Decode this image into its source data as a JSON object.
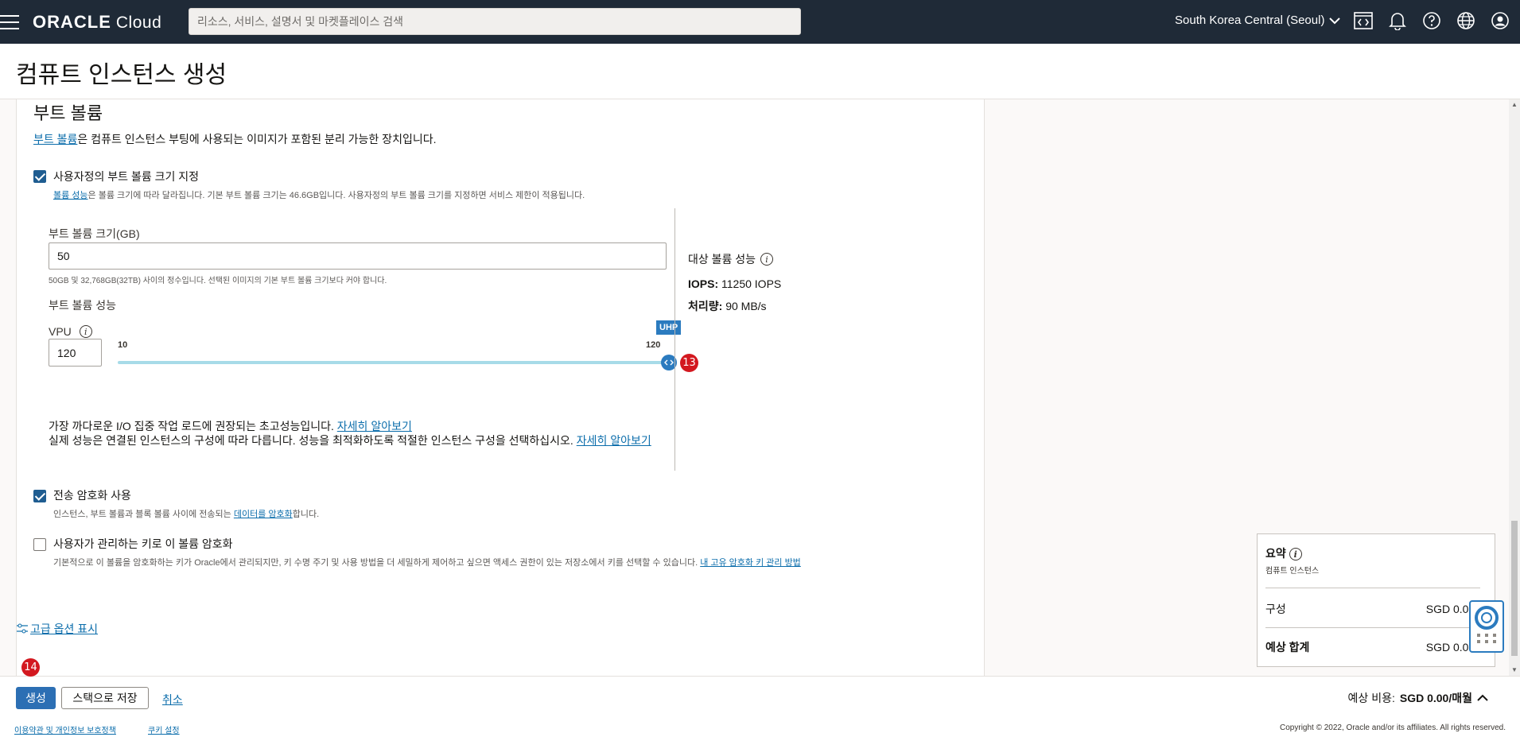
{
  "header": {
    "logo_brand": "ORACLE",
    "logo_product": "Cloud",
    "search_placeholder": "리소스, 서비스, 설명서 및 마켓플레이스 검색",
    "region": "South Korea Central (Seoul)",
    "icons": [
      "menu-icon",
      "code-editor-icon",
      "bell-icon",
      "help-icon",
      "globe-icon",
      "user-icon"
    ]
  },
  "page": {
    "title": "컴퓨트 인스턴스 생성"
  },
  "boot_volume": {
    "section_title": "부트 볼륨",
    "desc_link": "부트 볼륨",
    "desc_rest": "은 컴퓨트 인스턴스 부팅에 사용되는 이미지가 포함된 분리 가능한 장치입니다.",
    "custom_size_checkbox": {
      "label": "사용자정의 부트 볼륨 크기 지정",
      "checked": true
    },
    "custom_size_help_link": "볼륨 성능",
    "custom_size_help_rest": "은 볼륨 크기에 따라 달라집니다. 기본 부트 볼륨 크기는 46.6GB입니다. 사용자정의 부트 볼륨 크기를 지정하면 서비스 제한이 적용됩니다.",
    "size_label": "부트 볼륨 크기(GB)",
    "size_value": "50",
    "size_hint": "50GB 및 32,768GB(32TB) 사이의 정수입니다. 선택된 이미지의 기본 부트 볼륨 크기보다 커야 합니다.",
    "perf_label": "부트 볼륨 성능",
    "vpu_label": "VPU",
    "vpu_value": "120",
    "slider": {
      "min_label": "10",
      "max_label": "120",
      "tier_badge": "UHP",
      "value": 120,
      "min": 10,
      "max": 120
    },
    "perf_note_1": "가장 까다로운 I/O 집중 작업 로드에 권장되는 초고성능입니다.",
    "perf_note_1_link": "자세히 알아보기",
    "perf_note_2": "실제 성능은 연결된 인스턴스의 구성에 따라 다릅니다. 성능을 최적화하도록 적절한 인스턴스 구성을 선택하십시오.",
    "perf_note_2_link": "자세히 알아보기",
    "target_perf_title": "대상 볼륨 성능",
    "iops_label": "IOPS:",
    "iops_value": "11250 IOPS",
    "throughput_label": "처리량:",
    "throughput_value": "90 MB/s",
    "transit_checkbox": {
      "label": "전송 암호화 사용",
      "checked": true
    },
    "transit_help_pre": "인스턴스, 부트 볼륨과 블록 볼륨 사이에 전송되는 ",
    "transit_help_link": "데이터를 암호화",
    "transit_help_post": "합니다.",
    "cmk_checkbox": {
      "label": "사용자가 관리하는 키로 이 볼륨 암호화",
      "checked": false
    },
    "cmk_help": "기본적으로 이 볼륨을 암호화하는 키가 Oracle에서 관리되지만, 키 수명 주기 및 사용 방법을 더 세밀하게 제어하고 싶으면 액세스 권한이 있는 저장소에서 키를 선택할 수 있습니다.",
    "cmk_help_link": "내 고유 암호화 키 관리 방법"
  },
  "advanced_link": "고급 옵션 표시",
  "markers": {
    "m13": "13",
    "m14": "14"
  },
  "summary": {
    "title": "요약",
    "subtitle": "컴퓨트 인스턴스",
    "config_label": "구성",
    "config_value": "SGD 0.00/마",
    "total_label": "예상 합계",
    "total_value": "SGD 0.00/마"
  },
  "actions": {
    "create": "생성",
    "save_stack": "스택으로 저장",
    "cancel": "취소",
    "est_label": "예상 비용:",
    "est_value": "SGD 0.00/매월"
  },
  "footer": {
    "terms": "이용약관 및 개인정보 보호정책",
    "cookies": "쿠키 설정",
    "copyright": "Copyright © 2022, Oracle and/or its affiliates. All rights reserved."
  },
  "colors": {
    "topbar": "#1f2a37",
    "accent": "#2c6fb4",
    "marker": "#d3181f",
    "slider": "#a7dbe8"
  }
}
